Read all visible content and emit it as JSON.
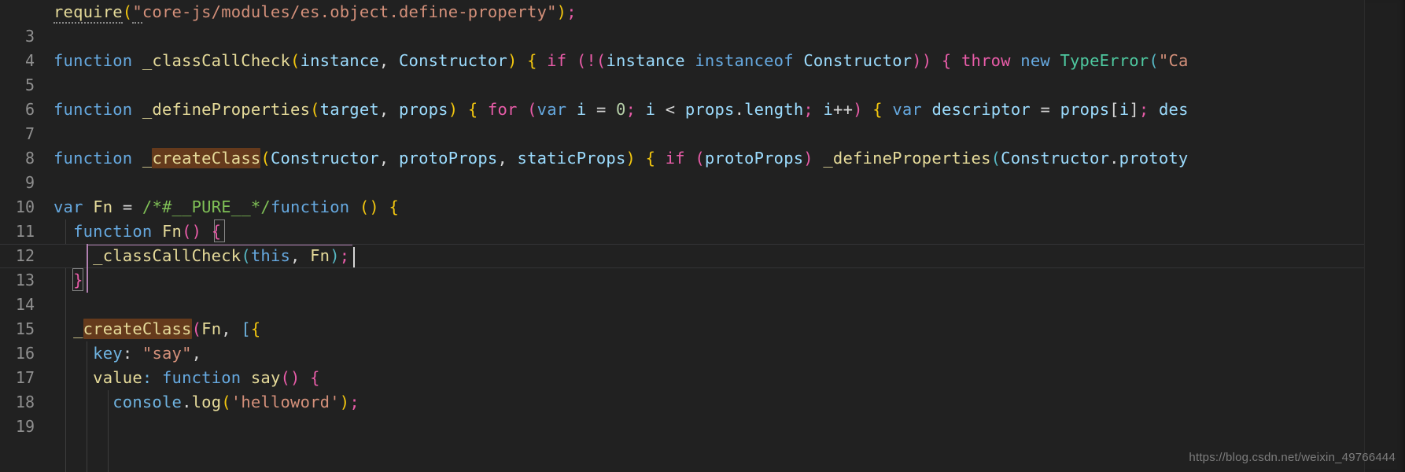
{
  "editor": {
    "theme_name": "dark",
    "background_color": "#212121",
    "gutter_color": "#8f8f8f",
    "first_visible_line": 3,
    "last_visible_line": 19,
    "current_line": 13,
    "cursor_position": "13:24",
    "find_match_term": "createClass",
    "find_match_color": "#653a1c",
    "language": "javascript"
  },
  "watermark": {
    "text": "https://blog.csdn.net/weixin_49766444"
  },
  "lines": [
    {
      "number": "3",
      "text": "require(\"core-js/modules/es.object.define-property\");"
    },
    {
      "number": "4",
      "text": ""
    },
    {
      "number": "5",
      "text": "function _classCallCheck(instance, Constructor) { if (!(instance instanceof Constructor)) { throw new TypeError(\"Ca"
    },
    {
      "number": "6",
      "text": ""
    },
    {
      "number": "7",
      "text": "function _defineProperties(target, props) { for (var i = 0; i < props.length; i++) { var descriptor = props[i]; des"
    },
    {
      "number": "8",
      "text": ""
    },
    {
      "number": "9",
      "text": "function _createClass(Constructor, protoProps, staticProps) { if (protoProps) _defineProperties(Constructor.prototy"
    },
    {
      "number": "10",
      "text": ""
    },
    {
      "number": "11",
      "text": "var Fn = /*#__PURE__*/function () {"
    },
    {
      "number": "12",
      "text": "  function Fn() {"
    },
    {
      "number": "13",
      "text": "    _classCallCheck(this, Fn);"
    },
    {
      "number": "14",
      "text": "  }"
    },
    {
      "number": "15",
      "text": ""
    },
    {
      "number": "16",
      "text": "  _createClass(Fn, [{"
    },
    {
      "number": "17",
      "text": "    key: \"say\","
    },
    {
      "number": "18",
      "text": "    value: function say() {"
    },
    {
      "number": "19",
      "text": "      console.log('helloword');"
    }
  ],
  "colors": {
    "keyword": "#66a9e0",
    "function_name": "#e6db9a",
    "identifier": "#9cdcfe",
    "string": "#d4907a",
    "punctuation_magenta": "#e85ca8",
    "paren_yellow": "#f2c60f",
    "comment_green": "#7fbf56",
    "type_teal": "#4ec9a0",
    "number": "#b5cea8",
    "plain_text": "#d6d6d6"
  }
}
